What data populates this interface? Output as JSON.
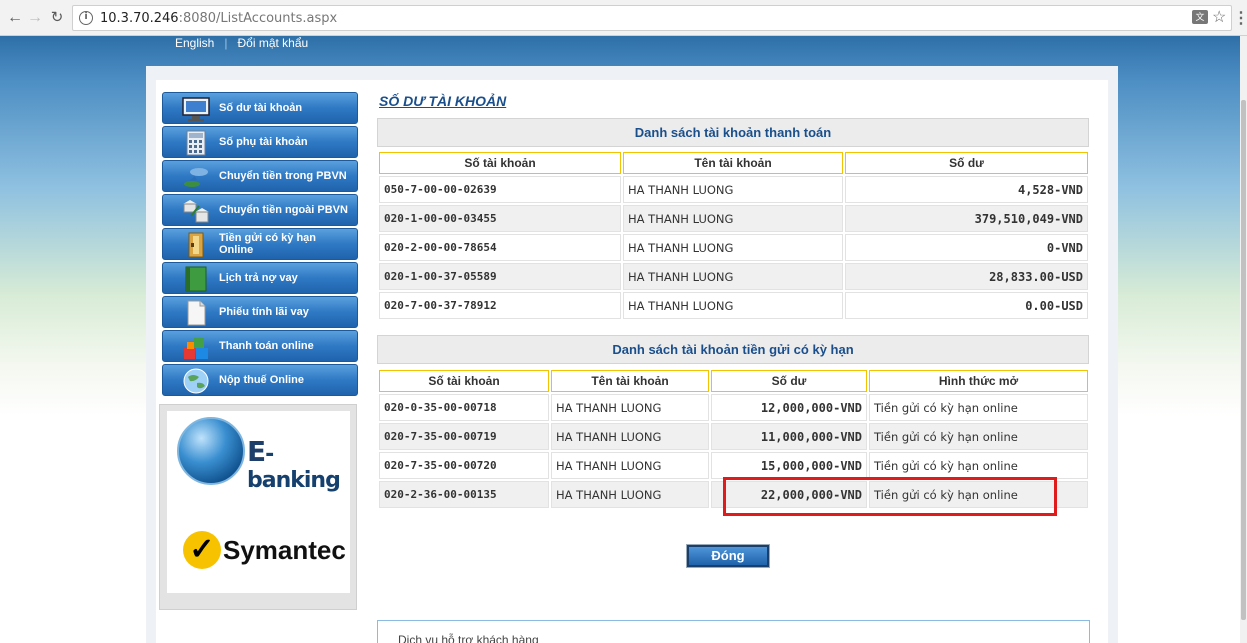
{
  "browser": {
    "url_host": "10.3.70.246",
    "url_rest": ":8080/ListAccounts.aspx"
  },
  "toplinks": {
    "english": "English",
    "change_password": "Đổi mật khẩu"
  },
  "sidebar": {
    "items": [
      {
        "label": "Số dư tài khoản",
        "icon": "monitor-icon"
      },
      {
        "label": "Số phụ tài khoản",
        "icon": "calculator-icon"
      },
      {
        "label": "Chuyển tiền trong PBVN",
        "icon": "transfer-icon"
      },
      {
        "label": "Chuyển tiền ngoài PBVN",
        "icon": "bank-transfer-icon"
      },
      {
        "label": "Tiền gửi có kỳ hạn Online",
        "icon": "folder-icon"
      },
      {
        "label": "Lịch trả nợ vay",
        "icon": "book-icon"
      },
      {
        "label": "Phiếu tính lãi vay",
        "icon": "document-icon"
      },
      {
        "label": "Thanh toán online",
        "icon": "blocks-icon"
      },
      {
        "label": "Nộp thuế Online",
        "icon": "globe-icon"
      }
    ]
  },
  "promo": {
    "ebanking_letter": "E",
    "ebanking_text": "-banking",
    "symantec_text": "Symantec"
  },
  "main": {
    "title": "SỐ DƯ TÀI KHOẢN",
    "payment": {
      "heading": "Danh sách tài khoản thanh toán",
      "columns": [
        "Số tài khoản",
        "Tên tài khoản",
        "Số dư"
      ],
      "rows": [
        [
          "050-7-00-00-02639",
          "HA THANH LUONG",
          "4,528-VND"
        ],
        [
          "020-1-00-00-03455",
          "HA THANH LUONG",
          "379,510,049-VND"
        ],
        [
          "020-2-00-00-78654",
          "HA THANH LUONG",
          "0-VND"
        ],
        [
          "020-1-00-37-05589",
          "HA THANH LUONG",
          "28,833.00-USD"
        ],
        [
          "020-7-00-37-78912",
          "HA THANH LUONG",
          "0.00-USD"
        ]
      ]
    },
    "term": {
      "heading": "Danh sách tài khoản tiền gửi có kỳ hạn",
      "columns": [
        "Số tài khoản",
        "Tên tài khoản",
        "Số dư",
        "Hình thức mở"
      ],
      "rows": [
        [
          "020-0-35-00-00718",
          "HA THANH LUONG",
          "12,000,000-VND",
          "Tiền gửi có kỳ hạn online"
        ],
        [
          "020-7-35-00-00719",
          "HA THANH LUONG",
          "11,000,000-VND",
          "Tiền gửi có kỳ hạn online"
        ],
        [
          "020-7-35-00-00720",
          "HA THANH LUONG",
          "15,000,000-VND",
          "Tiền gửi có kỳ hạn online"
        ],
        [
          "020-2-36-00-00135",
          "HA THANH LUONG",
          "22,000,000-VND",
          "Tiền gửi có kỳ hạn online"
        ]
      ]
    },
    "close_label": "Đóng",
    "support_label": "Dịch vụ hỗ trợ khách hàng"
  },
  "colors": {
    "accent": "#1a4f8c",
    "nav_blue": "#2f79c4",
    "highlight": "#e01b1b",
    "header_border": "#f2c300"
  }
}
